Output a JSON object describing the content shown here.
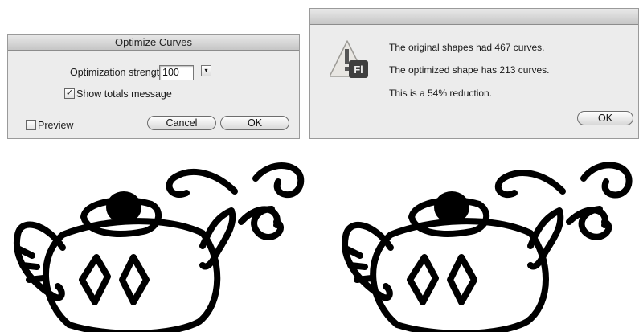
{
  "optimize_dialog": {
    "title": "Optimize Curves",
    "strength_label": "Optimization strength:",
    "strength_value": "100",
    "dropdown_arrow": "▾",
    "show_totals_label": "Show totals message",
    "show_totals_checked": true,
    "preview_label": "Preview",
    "preview_checked": false,
    "cancel_label": "Cancel",
    "ok_label": "OK"
  },
  "alert_dialog": {
    "title": "",
    "icon": "flash-app-warning-icon",
    "icon_text": "Fl",
    "line1": "The original shapes had 467 curves.",
    "line2": "The optimized shape has 213 curves.",
    "line3": "This is a 54% reduction.",
    "ok_label": "OK"
  },
  "illustrations": {
    "before": "teapot-drawing-original",
    "after": "teapot-drawing-optimized"
  }
}
